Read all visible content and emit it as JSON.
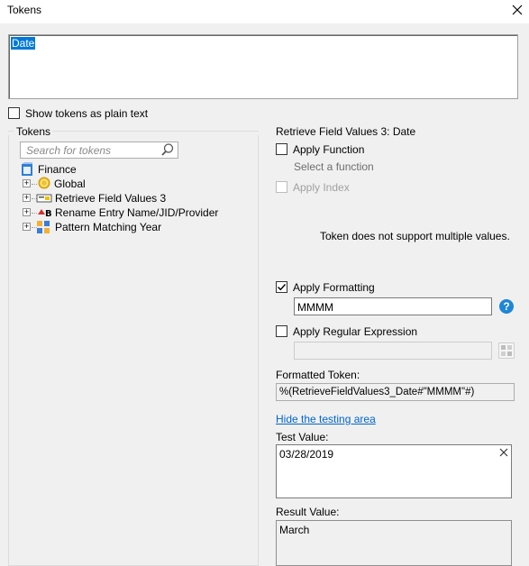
{
  "window": {
    "title": "Tokens"
  },
  "editor": {
    "token_text": "Date"
  },
  "show_plain": {
    "label": "Show tokens as plain text",
    "checked": false
  },
  "tokens_group": {
    "title": "Tokens",
    "search_placeholder": "Search for tokens",
    "root": "Finance",
    "items": [
      {
        "label": "Global",
        "icon": "coin-icon"
      },
      {
        "label": "Retrieve Field Values 3",
        "icon": "field-values-icon"
      },
      {
        "label": "Rename Entry Name/JID/Provider",
        "icon": "rename-icon"
      },
      {
        "label": "Pattern Matching Year",
        "icon": "pattern-icon"
      }
    ]
  },
  "right_panel": {
    "title": "Retrieve Field Values 3: Date",
    "apply_function": {
      "label": "Apply Function",
      "checked": false,
      "hint": "Select a function"
    },
    "apply_index": {
      "label": "Apply Index",
      "checked": false,
      "disabled": true
    },
    "multi_msg": "Token does not support multiple values.",
    "apply_formatting": {
      "label": "Apply Formatting",
      "checked": true,
      "value": "MMMM"
    },
    "apply_regex": {
      "label": "Apply Regular Expression",
      "checked": false,
      "value": ""
    },
    "formatted_label": "Formatted Token:",
    "formatted_value": "%(RetrieveFieldValues3_Date#\"MMMM\"#)",
    "hide_link": "Hide the testing area",
    "test_label": "Test Value:",
    "test_value": "03/28/2019",
    "result_label": "Result Value:",
    "result_value": "March"
  }
}
